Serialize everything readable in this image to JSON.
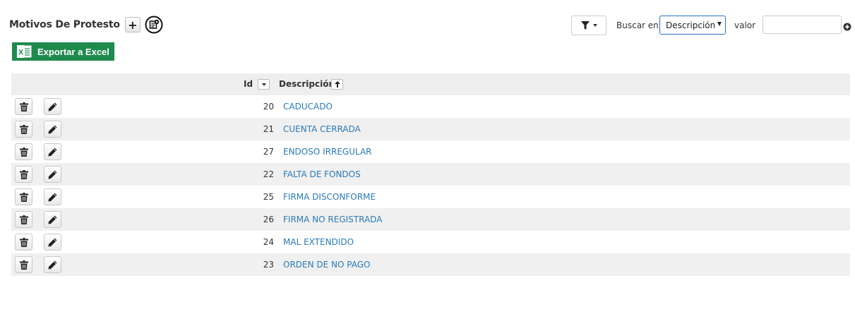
{
  "header": {
    "title": "Motivos De Protesto",
    "add_label": "+"
  },
  "toolbar": {
    "export_label": "Exportar a Excel",
    "search_in_label": "Buscar en",
    "search_field_selected": "Descripción",
    "value_label": "valor",
    "value_input": ""
  },
  "table": {
    "columns": {
      "id": "Id",
      "description": "Descripción"
    },
    "rows": [
      {
        "id": "20",
        "description": "CADUCADO"
      },
      {
        "id": "21",
        "description": "CUENTA CERRADA"
      },
      {
        "id": "27",
        "description": "ENDOSO IRREGULAR"
      },
      {
        "id": "22",
        "description": "FALTA DE FONDOS"
      },
      {
        "id": "25",
        "description": "FIRMA DISCONFORME"
      },
      {
        "id": "26",
        "description": "FIRMA NO REGISTRADA"
      },
      {
        "id": "24",
        "description": "MAL EXTENDIDO"
      },
      {
        "id": "23",
        "description": "ORDEN DE NO PAGO"
      }
    ]
  },
  "icons": {
    "add": "plus-icon",
    "config": "settings-doc-icon",
    "export": "excel-icon",
    "filter": "funnel-icon",
    "delete": "trash-icon",
    "edit": "pencil-icon",
    "add_filter": "plus-circle-icon"
  },
  "colors": {
    "excel_green": "#1e8a4c",
    "link_blue": "#2a7ab8",
    "select_border": "#2a6fc9"
  }
}
